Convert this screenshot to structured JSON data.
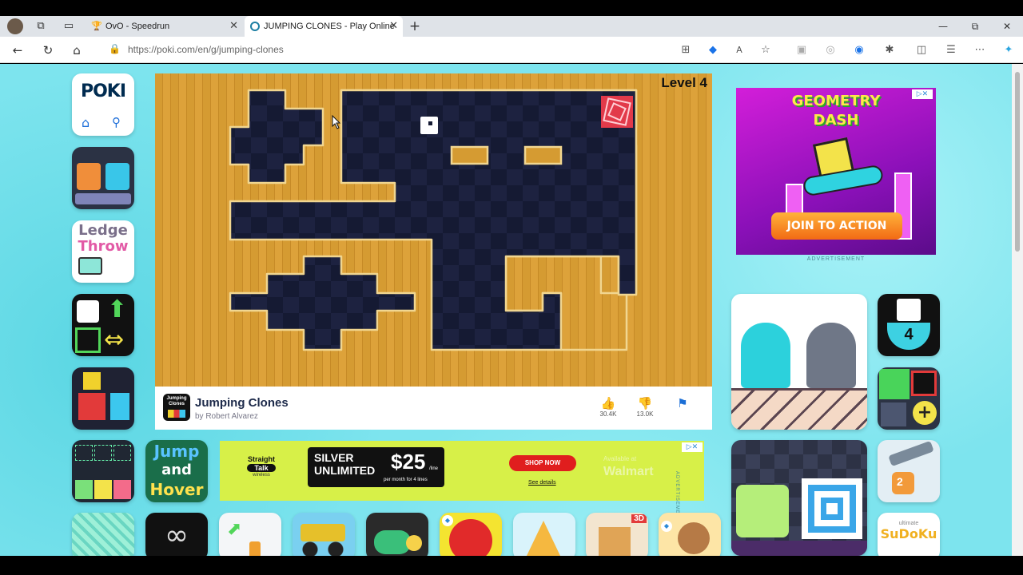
{
  "browser": {
    "tabs": [
      {
        "title": "OvO - Speedrun",
        "favicon": "trophy-icon"
      },
      {
        "title": "JUMPING CLONES - Play Online",
        "favicon": "poki-icon"
      }
    ],
    "new_tab_symbol": "+",
    "url": "https://poki.com/en/g/jumping-clones"
  },
  "poki": {
    "logo": "POKI"
  },
  "left_tiles": {
    "ledge_throw": [
      "Ledge",
      "Throw"
    ],
    "jump_hover": [
      "Jump",
      "and",
      "Hover"
    ]
  },
  "game": {
    "level": "Level 4",
    "title": "Jumping Clones",
    "author": "by Robert Alvarez",
    "likes": "30.4K",
    "dislikes": "13.0K",
    "thumb_text": [
      "Jumping",
      "Clones"
    ]
  },
  "ad_right": {
    "title_line1": "GEOMETRY",
    "title_line2": "DASH",
    "cta": "JOIN TO ACTION",
    "label": "ADVERTISEMENT"
  },
  "ad_bottom": {
    "brand_line1": "Straight",
    "brand_line2": "Talk",
    "brand_line3": "wireless",
    "plan_line1": "SILVER",
    "plan_line2": "UNLIMITED",
    "price": "$25",
    "price_suffix": "/line",
    "price_note": "per month for 4 lines",
    "cta": "SHOP NOW",
    "see_details": "See details",
    "retailer_line1": "Available at",
    "retailer_line2": "Walmart",
    "side_label": "ADVERTISEMENT"
  },
  "right_tiles": {
    "level_badge": "4",
    "sudoku_small": "ultimate",
    "sudoku": "SuDoKu"
  },
  "bottom_tiles": {
    "tile3d": "3D",
    "badge2": "2"
  }
}
